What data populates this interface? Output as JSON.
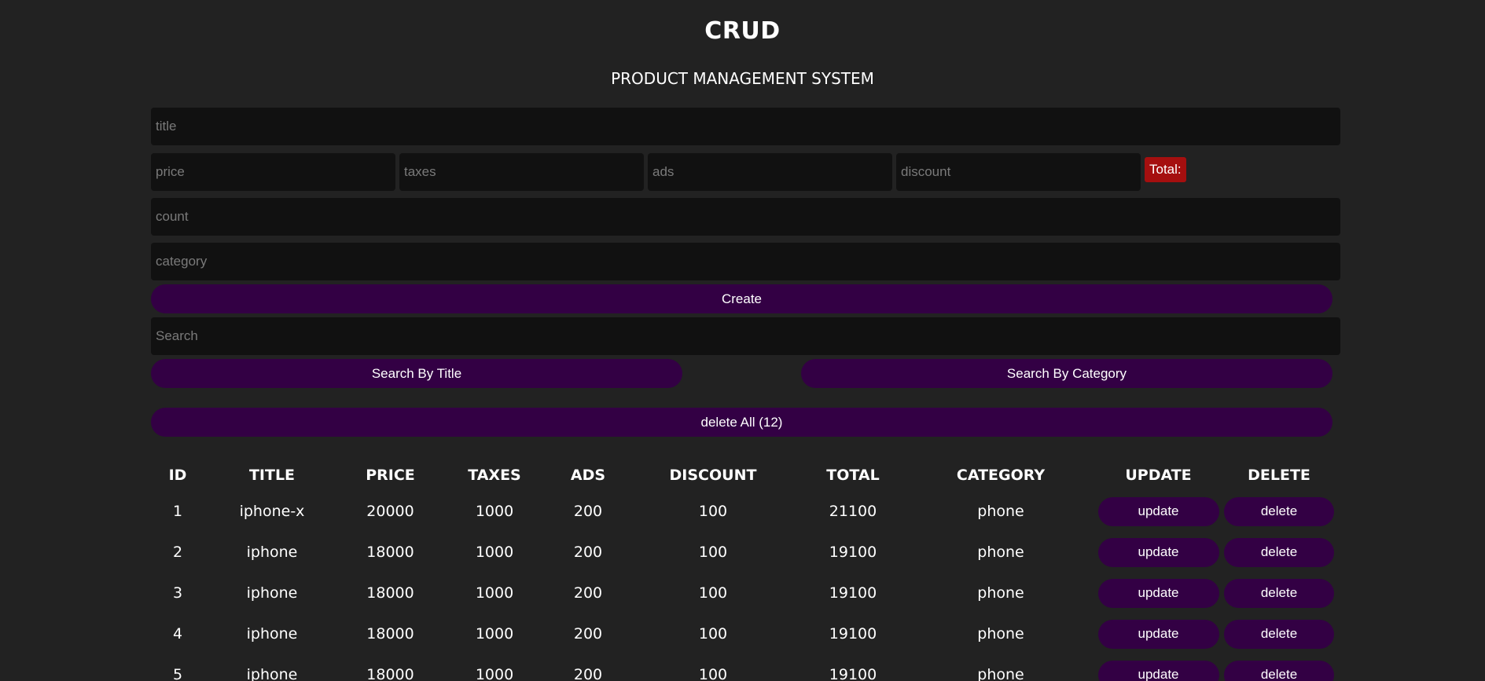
{
  "header": {
    "title": "CRUD",
    "subtitle": "PRODUCT MANAGEMENT SYSTEM"
  },
  "form": {
    "title_placeholder": "title",
    "price_placeholder": "price",
    "taxes_placeholder": "taxes",
    "ads_placeholder": "ads",
    "discount_placeholder": "discount",
    "total_label": "Total:",
    "count_placeholder": "count",
    "category_placeholder": "category",
    "create_label": "Create"
  },
  "search": {
    "placeholder": "Search",
    "by_title_label": "Search By Title",
    "by_category_label": "Search By Category"
  },
  "delete_all_label": "delete All (12)",
  "table": {
    "headers": [
      "ID",
      "TITLE",
      "PRICE",
      "TAXES",
      "ADS",
      "DISCOUNT",
      "TOTAL",
      "CATEGORY",
      "UPDATE",
      "DELETE"
    ],
    "update_label": "update",
    "delete_label": "delete",
    "rows": [
      {
        "id": "1",
        "title": "iphone-x",
        "price": "20000",
        "taxes": "1000",
        "ads": "200",
        "discount": "100",
        "total": "21100",
        "category": "phone"
      },
      {
        "id": "2",
        "title": "iphone",
        "price": "18000",
        "taxes": "1000",
        "ads": "200",
        "discount": "100",
        "total": "19100",
        "category": "phone"
      },
      {
        "id": "3",
        "title": "iphone",
        "price": "18000",
        "taxes": "1000",
        "ads": "200",
        "discount": "100",
        "total": "19100",
        "category": "phone"
      },
      {
        "id": "4",
        "title": "iphone",
        "price": "18000",
        "taxes": "1000",
        "ads": "200",
        "discount": "100",
        "total": "19100",
        "category": "phone"
      },
      {
        "id": "5",
        "title": "iphone",
        "price": "18000",
        "taxes": "1000",
        "ads": "200",
        "discount": "100",
        "total": "19100",
        "category": "phone"
      }
    ]
  },
  "colors": {
    "background": "#222222",
    "input_background": "#111111",
    "button_background": "#330044",
    "total_badge": "#a50f0f"
  }
}
